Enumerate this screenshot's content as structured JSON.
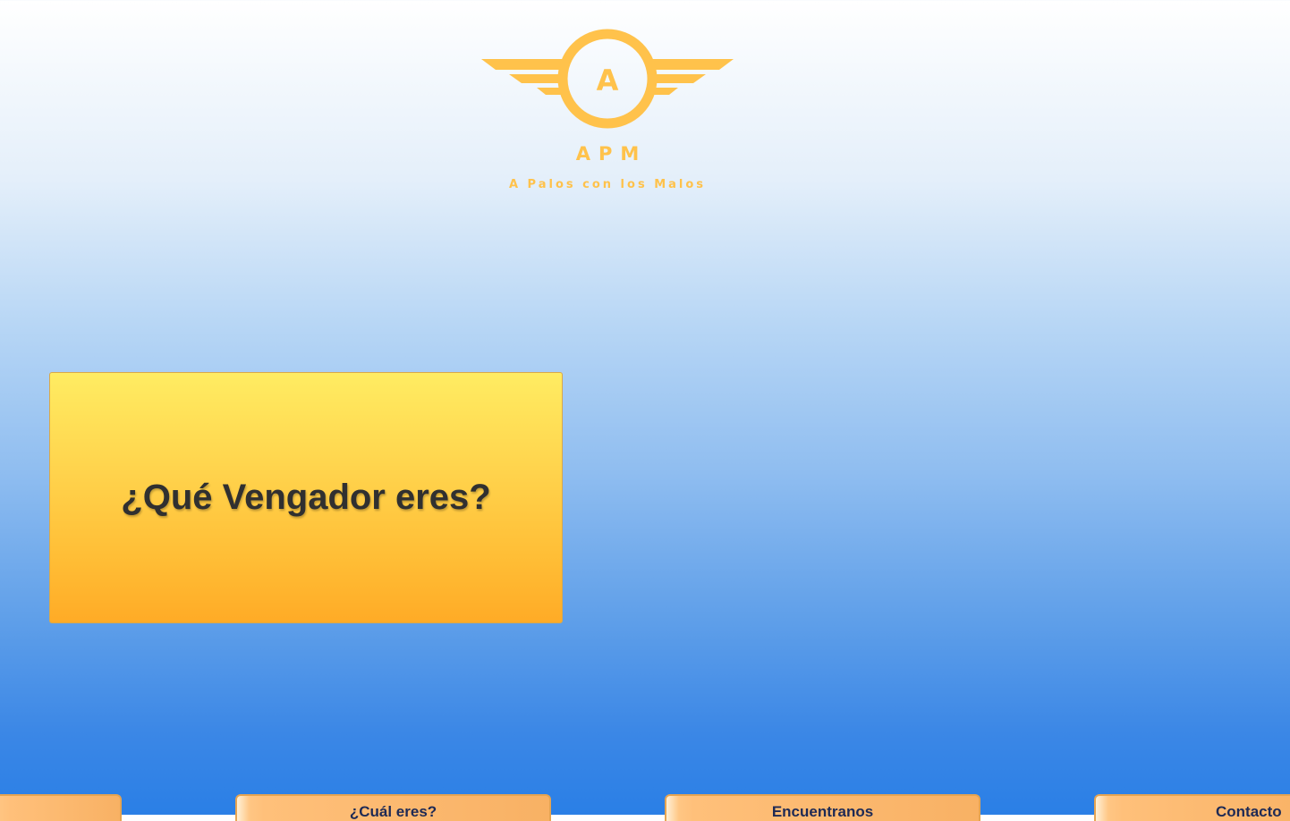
{
  "brand": {
    "emblem_letter": "A",
    "title": "APM",
    "subtitle": "A Palos con los Malos",
    "color": "#ffc24b"
  },
  "hero": {
    "title": "¿Qué Vengador eres?",
    "gradient_top": "#ffec62",
    "gradient_bottom": "#ffab26"
  },
  "nav": {
    "items": [
      {
        "label": ""
      },
      {
        "label": "¿Cuál eres?"
      },
      {
        "label": "Encuentranos"
      },
      {
        "label": "Contacto"
      }
    ]
  },
  "colors": {
    "background_top": "#ffffff",
    "background_bottom": "#2a7fe6",
    "nav_text": "#1e2a55"
  }
}
